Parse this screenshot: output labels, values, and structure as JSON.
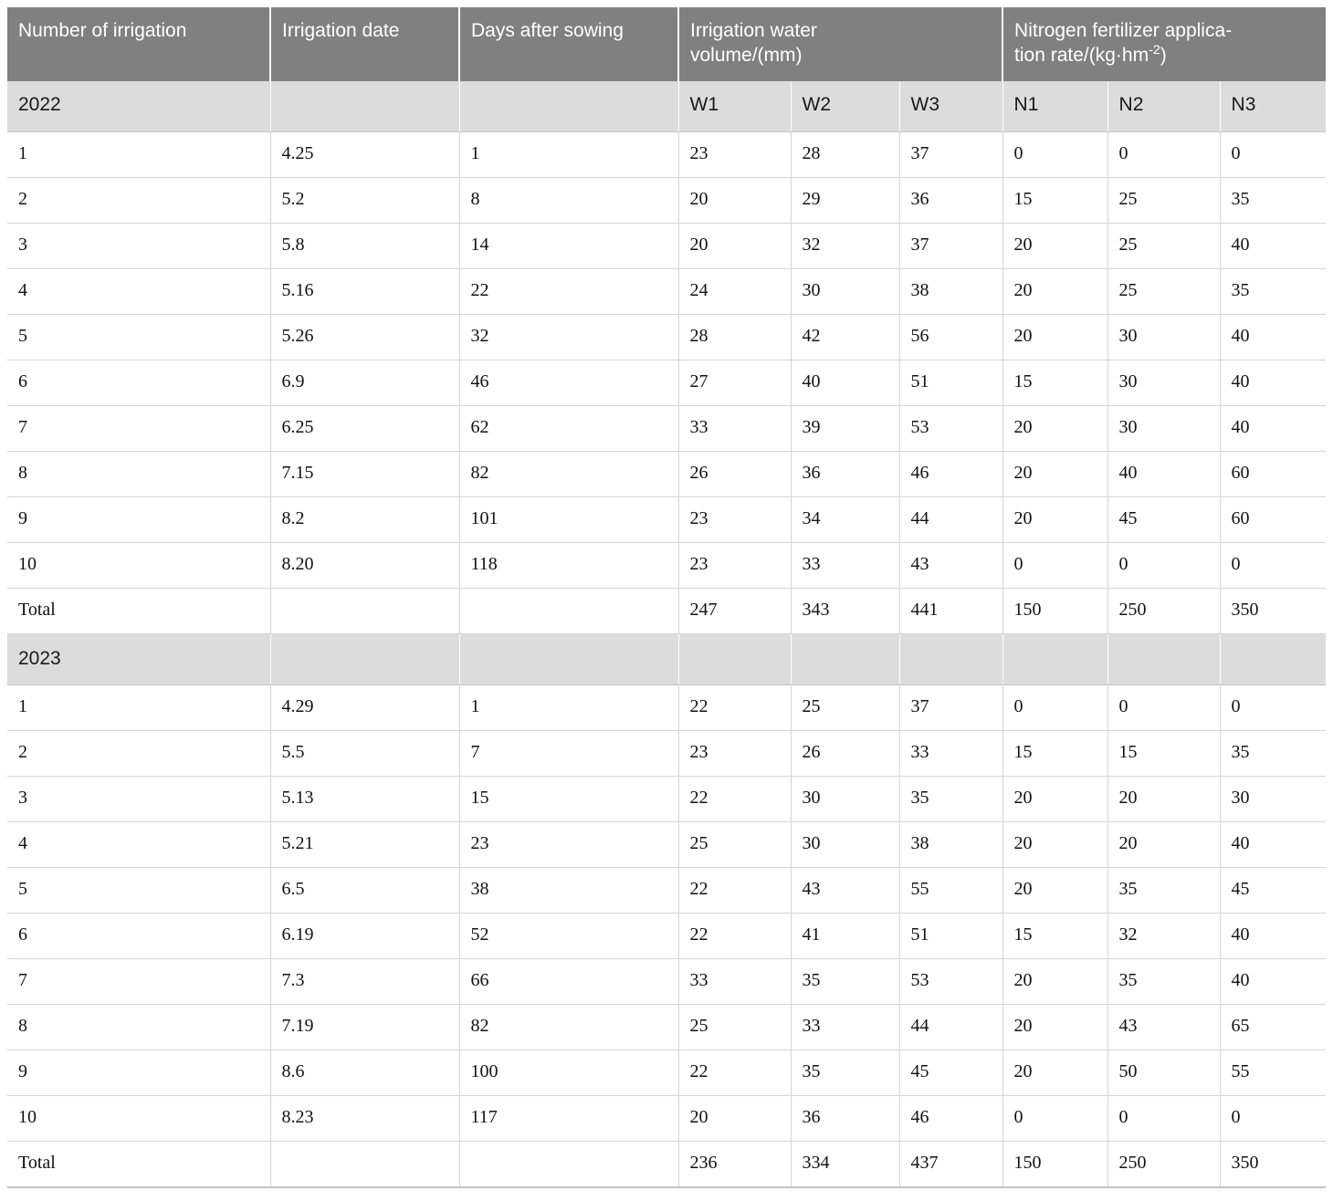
{
  "table": {
    "headers": {
      "col_number": "Number of irrigation",
      "col_date": "Irrigation date",
      "col_days": "Days after sowing",
      "group_water": "Irrigation water volume/(mm)",
      "group_water_line1": "Irrigation water",
      "group_water_line2": "volume/(mm)",
      "group_nitrogen": "Nitrogen fertilizer application rate/(kg·hm-2)",
      "group_nitrogen_line1": "Nitrogen fertilizer applica-",
      "group_nitrogen_line2_pre": "tion rate/(kg·hm",
      "group_nitrogen_exp": "-2",
      "group_nitrogen_line2_post": ")",
      "sub_w1": "W1",
      "sub_w2": "W2",
      "sub_w3": "W3",
      "sub_n1": "N1",
      "sub_n2": "N2",
      "sub_n3": "N3"
    },
    "colors": {
      "header_bg": "#808080",
      "header_text": "#ffffff",
      "subheader_bg": "#dcdcdc",
      "body_bg": "#ffffff",
      "grid_line": "#d5d5d5",
      "body_text": "#111111"
    },
    "sections": [
      {
        "year": "2022",
        "rows": [
          {
            "number": "1",
            "date": "4.25",
            "days": "1",
            "w1": "23",
            "w2": "28",
            "w3": "37",
            "n1": "0",
            "n2": "0",
            "n3": "0"
          },
          {
            "number": "2",
            "date": "5.2",
            "days": "8",
            "w1": "20",
            "w2": "29",
            "w3": "36",
            "n1": "15",
            "n2": "25",
            "n3": "35"
          },
          {
            "number": "3",
            "date": "5.8",
            "days": "14",
            "w1": "20",
            "w2": "32",
            "w3": "37",
            "n1": "20",
            "n2": "25",
            "n3": "40"
          },
          {
            "number": "4",
            "date": "5.16",
            "days": "22",
            "w1": "24",
            "w2": "30",
            "w3": "38",
            "n1": "20",
            "n2": "25",
            "n3": "35"
          },
          {
            "number": "5",
            "date": "5.26",
            "days": "32",
            "w1": "28",
            "w2": "42",
            "w3": "56",
            "n1": "20",
            "n2": "30",
            "n3": "40"
          },
          {
            "number": "6",
            "date": "6.9",
            "days": "46",
            "w1": "27",
            "w2": "40",
            "w3": "51",
            "n1": "15",
            "n2": "30",
            "n3": "40"
          },
          {
            "number": "7",
            "date": "6.25",
            "days": "62",
            "w1": "33",
            "w2": "39",
            "w3": "53",
            "n1": "20",
            "n2": "30",
            "n3": "40"
          },
          {
            "number": "8",
            "date": "7.15",
            "days": "82",
            "w1": "26",
            "w2": "36",
            "w3": "46",
            "n1": "20",
            "n2": "40",
            "n3": "60"
          },
          {
            "number": "9",
            "date": "8.2",
            "days": "101",
            "w1": "23",
            "w2": "34",
            "w3": "44",
            "n1": "20",
            "n2": "45",
            "n3": "60"
          },
          {
            "number": "10",
            "date": "8.20",
            "days": "118",
            "w1": "23",
            "w2": "33",
            "w3": "43",
            "n1": "0",
            "n2": "0",
            "n3": "0"
          },
          {
            "number": "Total",
            "date": "",
            "days": "",
            "w1": "247",
            "w2": "343",
            "w3": "441",
            "n1": "150",
            "n2": "250",
            "n3": "350"
          }
        ]
      },
      {
        "year": "2023",
        "rows": [
          {
            "number": "1",
            "date": "4.29",
            "days": "1",
            "w1": "22",
            "w2": "25",
            "w3": "37",
            "n1": "0",
            "n2": "0",
            "n3": "0"
          },
          {
            "number": "2",
            "date": "5.5",
            "days": "7",
            "w1": "23",
            "w2": "26",
            "w3": "33",
            "n1": "15",
            "n2": "15",
            "n3": "35"
          },
          {
            "number": "3",
            "date": "5.13",
            "days": "15",
            "w1": "22",
            "w2": "30",
            "w3": "35",
            "n1": "20",
            "n2": "20",
            "n3": "30"
          },
          {
            "number": "4",
            "date": "5.21",
            "days": "23",
            "w1": "25",
            "w2": "30",
            "w3": "38",
            "n1": "20",
            "n2": "20",
            "n3": "40"
          },
          {
            "number": "5",
            "date": "6.5",
            "days": "38",
            "w1": "22",
            "w2": "43",
            "w3": "55",
            "n1": "20",
            "n2": "35",
            "n3": "45"
          },
          {
            "number": "6",
            "date": "6.19",
            "days": "52",
            "w1": "22",
            "w2": "41",
            "w3": "51",
            "n1": "15",
            "n2": "32",
            "n3": "40"
          },
          {
            "number": "7",
            "date": "7.3",
            "days": "66",
            "w1": "33",
            "w2": "35",
            "w3": "53",
            "n1": "20",
            "n2": "35",
            "n3": "40"
          },
          {
            "number": "8",
            "date": "7.19",
            "days": "82",
            "w1": "25",
            "w2": "33",
            "w3": "44",
            "n1": "20",
            "n2": "43",
            "n3": "65"
          },
          {
            "number": "9",
            "date": "8.6",
            "days": "100",
            "w1": "22",
            "w2": "35",
            "w3": "45",
            "n1": "20",
            "n2": "50",
            "n3": "55"
          },
          {
            "number": "10",
            "date": "8.23",
            "days": "117",
            "w1": "20",
            "w2": "36",
            "w3": "46",
            "n1": "0",
            "n2": "0",
            "n3": "0"
          },
          {
            "number": "Total",
            "date": "",
            "days": "",
            "w1": "236",
            "w2": "334",
            "w3": "437",
            "n1": "150",
            "n2": "250",
            "n3": "350"
          }
        ]
      }
    ]
  }
}
